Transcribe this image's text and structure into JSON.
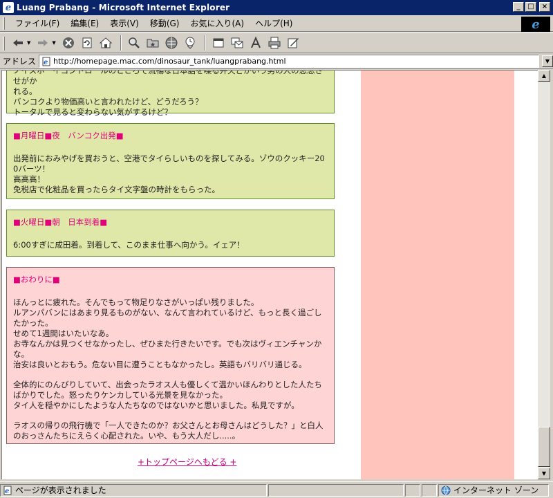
{
  "window": {
    "title": "Luang Prabang - Microsoft Internet Explorer",
    "minimize": "_",
    "maximize": "□",
    "close": "×"
  },
  "menu": {
    "items": [
      "ファイル(F)",
      "編集(E)",
      "表示(V)",
      "移動(G)",
      "お気に入り(A)",
      "ヘルプ(H)"
    ]
  },
  "brand": {
    "logo_letter": "e"
  },
  "address": {
    "label": "アドレス",
    "url": "http://homepage.mac.com/dinosaur_tank/luangprabang.html"
  },
  "content": {
    "box1": {
      "lines": [
        "ノイスホーイコントロールのところで流暢な日本語を喋る弁天どかいう男の人の思念させがか",
        "れる。",
        "バンコクより物価高いと言われたけど、どうだろう？",
        "トータルで見ると変わらない気がするけど？"
      ]
    },
    "box2": {
      "heading": "■月曜日■夜　バンコク出発■",
      "lines": [
        "出発前におみやげを買おうと、空港でタイらしいものを探してみる。ゾウのクッキー20",
        "0バーツ！",
        "高高高！",
        "免税店で化粧品を買ったらタイ文字盤の時計をもらった。"
      ]
    },
    "box3": {
      "heading": "■火曜日■朝　日本到着■",
      "lines": [
        "6:00すぎに成田着。到着して、このまま仕事へ向かう。イェア！"
      ]
    },
    "box4": {
      "heading": "■おわりに■",
      "para1": [
        "ほんっとに疲れた。そんでもって物足りなさがいっぱい残りました。",
        "ルアンパバンにはあまり見るものがない、なんて言われているけど、もっと長く過ごし",
        "たかった。",
        "せめて1週間はいたいなあ。",
        "お寺なんかは見つくせなかったし、ぜひまた行きたいです。でも次はヴィエンチャンか",
        "な。",
        "治安は良いとおもう。危ない目に遭うこともなかったし。英語もバリバリ通じる。"
      ],
      "para2": [
        "全体的にのんびりしていて、出会ったラオス人も優しくて温かいほんわりとした人たち",
        "ばかりでした。怒ったりケンカしている光景を見なかった。",
        "タイ人を穏やかにしたような人たちなのではないかと思いました。私見ですが。"
      ],
      "para3": [
        "ラオスの帰りの飛行機で「一人できたのか？お父さんとお母さんはどうした？」と白人",
        "のおっさんたちにえらく心配された。いや、もう大人だし.....。"
      ]
    },
    "top_link": "+トップページへもどる +"
  },
  "status": {
    "text": "ページが表示されました",
    "zone": "インターネット ゾーン"
  }
}
